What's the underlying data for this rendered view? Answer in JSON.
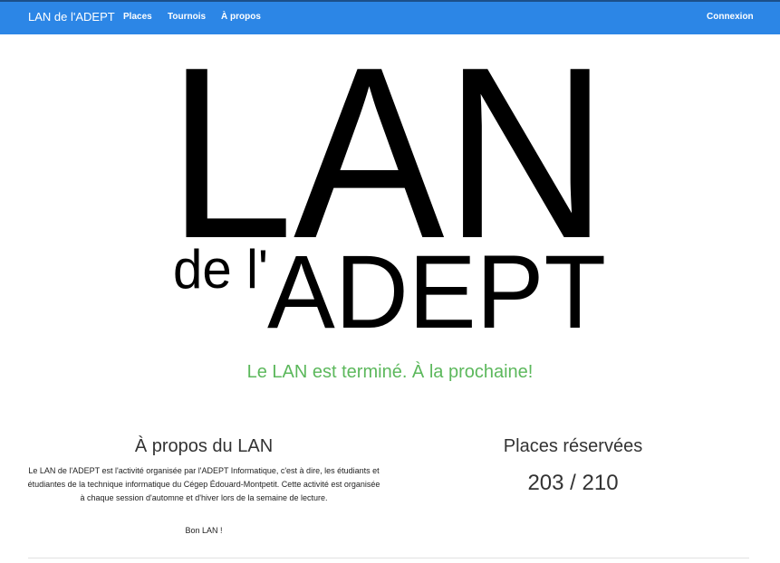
{
  "navbar": {
    "brand": "LAN de l'ADEPT",
    "links": [
      "Places",
      "Tournois",
      "À propos"
    ],
    "login": "Connexion",
    "color": "#2c86e6"
  },
  "logo": {
    "line1": "LAN",
    "line2_small": "de l'",
    "line2_big": "ADEPT"
  },
  "status": {
    "message": "Le LAN est terminé. À la prochaine!",
    "color": "#5cb85c"
  },
  "about": {
    "title": "À propos du LAN",
    "text": "Le LAN de l'ADEPT est l'activité organisée par l'ADEPT Informatique, c'est à dire, les étudiants et étudiantes de la technique informatique du Cégep Édouard-Montpetit. Cette activité est organisée à chaque session d'automne et d'hiver lors de la semaine de lecture.",
    "sign": "Bon LAN !"
  },
  "seats": {
    "title": "Places réservées",
    "reserved": "203",
    "separator": " / ",
    "total": "210"
  }
}
